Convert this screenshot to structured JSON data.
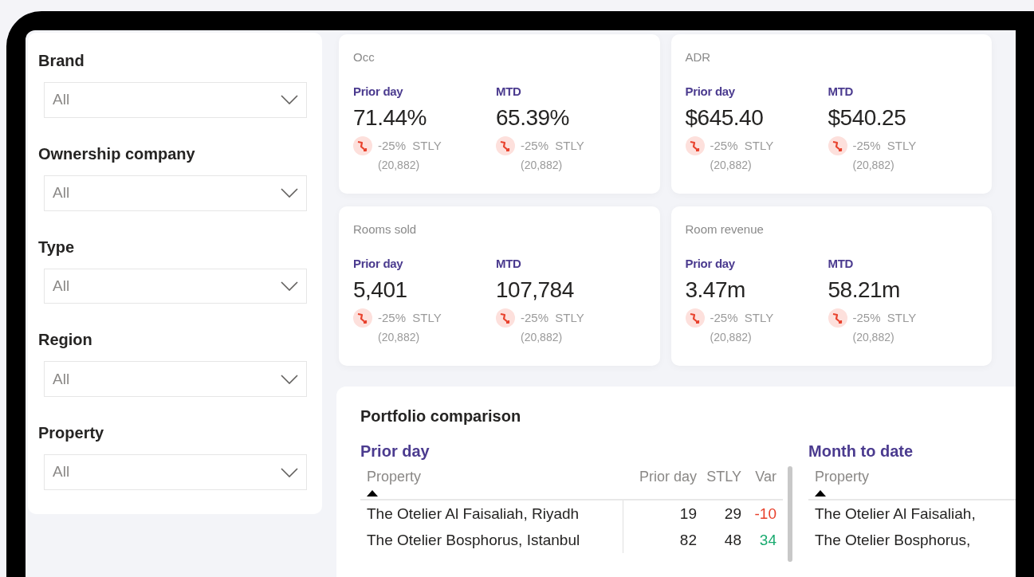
{
  "filters": [
    {
      "label": "Brand",
      "value": "All"
    },
    {
      "label": "Ownership company",
      "value": "All"
    },
    {
      "label": "Type",
      "value": "All"
    },
    {
      "label": "Region",
      "value": "All"
    },
    {
      "label": "Property",
      "value": "All"
    }
  ],
  "kpis": [
    {
      "title": "Occ",
      "metrics": [
        {
          "label": "Prior day",
          "value": "71.44%",
          "change": "-25%  STLY",
          "compare": "(20,882)",
          "down": true
        },
        {
          "label": "MTD",
          "value": "65.39%",
          "change": "-25%  STLY",
          "compare": "(20,882)",
          "down": true
        }
      ]
    },
    {
      "title": "ADR",
      "metrics": [
        {
          "label": "Prior day",
          "value": "$645.40",
          "change": "-25%  STLY",
          "compare": "(20,882)",
          "down": true
        },
        {
          "label": "MTD",
          "value": "$540.25",
          "change": "-25%  STLY",
          "compare": "(20,882)",
          "down": true
        }
      ]
    },
    {
      "title": "Rooms sold",
      "metrics": [
        {
          "label": "Prior day",
          "value": "5,401",
          "change": "-25%  STLY",
          "compare": "(20,882)",
          "down": true
        },
        {
          "label": "MTD",
          "value": "107,784",
          "change": "-25%  STLY",
          "compare": "(20,882)",
          "down": true
        }
      ]
    },
    {
      "title": "Room revenue",
      "metrics": [
        {
          "label": "Prior day",
          "value": "3.47m",
          "change": "-25%  STLY",
          "compare": "(20,882)",
          "down": true
        },
        {
          "label": "MTD",
          "value": "58.21m",
          "change": "-25%  STLY",
          "compare": "(20,882)",
          "down": true
        }
      ]
    }
  ],
  "portfolio": {
    "title": "Portfolio comparison",
    "sections": [
      {
        "title": "Prior day",
        "columns": [
          {
            "label": "Property",
            "sorted": true
          },
          {
            "label": "Prior day",
            "sorted": false
          },
          {
            "label": "STLY",
            "sorted": false
          },
          {
            "label": "Var",
            "sorted": false
          }
        ],
        "rows": [
          {
            "cells": [
              "The Otelier Al Faisaliah, Riyadh",
              "19",
              "29",
              "-10"
            ],
            "negative": true
          },
          {
            "cells": [
              "The Otelier Bosphorus, Istanbul",
              "82",
              "48",
              "34"
            ],
            "negative": false
          }
        ]
      },
      {
        "title": "Month to date",
        "columns": [
          {
            "label": "Property",
            "sorted": true
          }
        ],
        "rows": [
          {
            "cells": [
              "The Otelier Al Faisaliah,"
            ]
          },
          {
            "cells": [
              "The Otelier Bosphorus,"
            ]
          }
        ]
      }
    ]
  }
}
